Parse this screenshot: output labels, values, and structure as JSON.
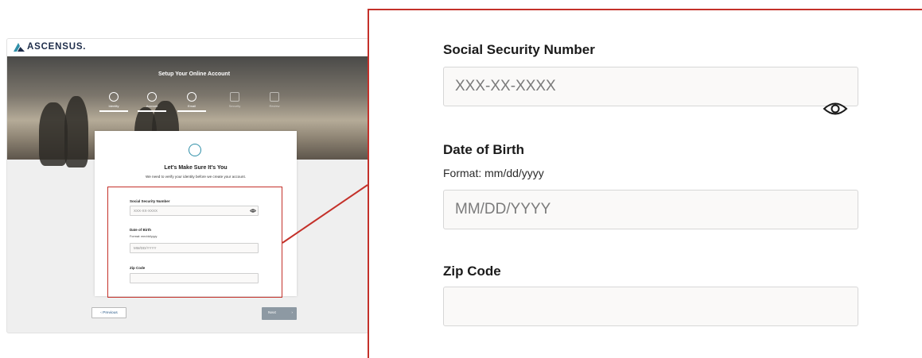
{
  "brand": {
    "name": "ASCENSUS.",
    "accent": "#2f8fa8",
    "highlight": "#c4312a"
  },
  "hero": {
    "title": "Setup Your Online Account",
    "steps": [
      {
        "label": "Identity",
        "state": "active"
      },
      {
        "label": "Account",
        "state": "active"
      },
      {
        "label": "Email",
        "state": "active"
      },
      {
        "label": "Security",
        "state": "upcoming"
      },
      {
        "label": "Review",
        "state": "upcoming"
      }
    ]
  },
  "card": {
    "icon": "fingerprint-icon",
    "title": "Let's Make Sure It's You",
    "subtitle": "We need to verify your identity before we create your account."
  },
  "form": {
    "ssn": {
      "label": "Social Security Number",
      "placeholder": "XXX-XX-XXXX",
      "icon": "eye-icon"
    },
    "dob": {
      "label": "Date of Birth",
      "help": "Format: mm/dd/yyyy",
      "placeholder": "MM/DD/YYYY"
    },
    "zip": {
      "label": "Zip Code",
      "placeholder": ""
    }
  },
  "nav": {
    "previous": "‹ Previous",
    "next": "Next",
    "next_arrow": "›"
  }
}
